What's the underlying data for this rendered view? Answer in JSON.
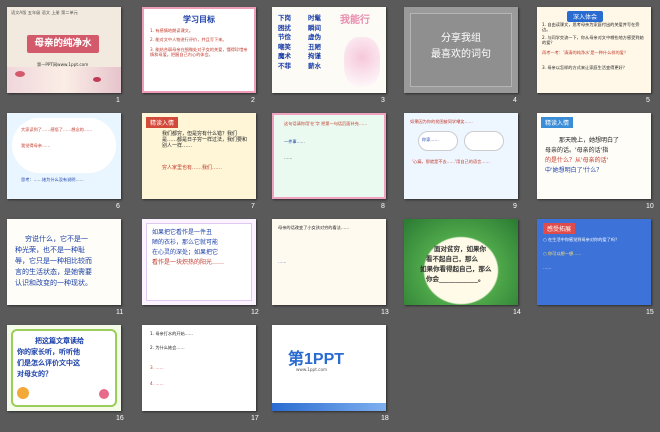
{
  "slides": [
    {
      "num": "1",
      "title": "母亲的纯净水",
      "header": "语文A版 五年级 语文 上册 第二单元",
      "footer": "第一PPT网www.1ppt.com"
    },
    {
      "num": "2",
      "title": "学习目标",
      "lines": [
        "1. 有感情地朗读课文。",
        "2. 能对文中人物进行评价，并且写下来。",
        "3. 能结合弱母亲在细微处对子女的关爱，懂得珍惜亲情和母爱。把握自己内心的体会。"
      ]
    },
    {
      "num": "3",
      "heading": "我能行",
      "words": [
        "下岗",
        "时髦",
        "困扰",
        "瞬间",
        "节俭",
        "虚伪",
        "嘲笑",
        "丑陋",
        "魔术",
        "拘谨",
        "不菲",
        "薪水"
      ]
    },
    {
      "num": "4",
      "lines": [
        "分享我组",
        "最喜欢的词句"
      ]
    },
    {
      "num": "5",
      "title": "深入体会",
      "lines": [
        "1. 自由读课文，思考母亲为家庭付出的关爱并写在旁边。",
        "2. 与同学交流一下，你从母亲对文中哪些地方感受到她的爱？",
        "再考一考：'清清的纯净水'是一种什么样的爱？",
        "3. 母亲以怎样的方式来让家庭生活变得更好？"
      ]
    },
    {
      "num": "6",
      "lines": [
        "大家读到了……感悟了……想念的……",
        "我觉得母亲……",
        "思考：……她为什么没有说明……"
      ]
    },
    {
      "num": "7",
      "title": "精读入情",
      "lines": [
        "我们都穷，但是穷有什么错？我们是……都是日子穷一样过法，我们要和别人一样……",
        "穷人家里也有……我们……"
      ]
    },
    {
      "num": "8",
      "lines": [
        "这句话请你用'在'字 把第一句话后面补充……",
        "一件事……",
        "……"
      ]
    },
    {
      "num": "9",
      "lines": [
        "如果因为你的贫困被同学嘲笑……",
        "你家……",
        "'心痛，那就是不去……'用自己的语言……"
      ]
    },
    {
      "num": "10",
      "title": "精读入情",
      "lines": [
        "那天晚上，她想明白了",
        "母亲的话。'母亲的话'指",
        "的是什么？从'母亲的话'",
        "中'她想明白了'什么？"
      ]
    },
    {
      "num": "11",
      "lines": [
        "穷说什么，它不是一",
        "种光荣，也不是一种耻",
        "辱，它只是一种相比较而",
        "言的生活状态，是她需要",
        "认识和改变的一种现状。"
      ]
    },
    {
      "num": "12",
      "lines": [
        "如果把它看作是一件丑",
        "陋的衣衫，那么它就可能",
        "在心灵的深处；如果把它",
        "看作是一块炽热的阳光……"
      ]
    },
    {
      "num": "13",
      "lines": [
        "母亲的话改变了小女孩对穷的看法……",
        "……"
      ]
    },
    {
      "num": "14",
      "lines": [
        "面对贫穷，如果你",
        "看不起自己，那么",
        "如果你看得起自己，那么",
        "你会____________。"
      ]
    },
    {
      "num": "15",
      "title": "感受拓展",
      "lines": [
        "○ 在生活中你感觉到母亲对你的爱了吗？",
        "○ 你可以想一想……",
        "……"
      ]
    },
    {
      "num": "16",
      "lines": [
        "把这篇文章读给",
        "你的家长听，听听他",
        "们是怎么评价文中这",
        "对母女的？"
      ]
    },
    {
      "num": "17",
      "lines": [
        "1. 母亲打水的开始……",
        "2. 为什么她会……",
        "3. ……",
        "4. ……"
      ]
    },
    {
      "num": "18",
      "logo": "第1PPT",
      "sub": "www.1ppt.com"
    }
  ]
}
